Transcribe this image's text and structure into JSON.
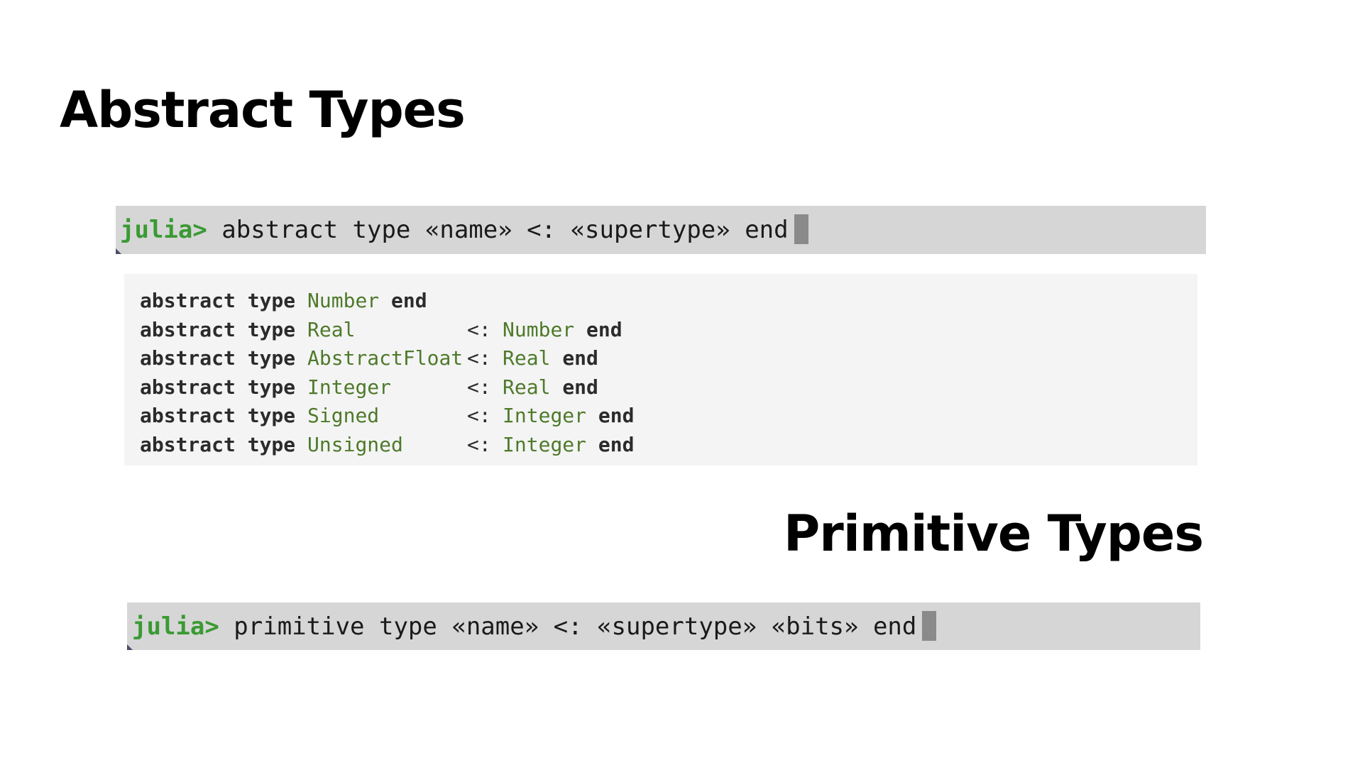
{
  "headings": {
    "abstract": "Abstract Types",
    "primitive": "Primitive Types"
  },
  "repl_abstract": {
    "prompt": "julia>",
    "command": " abstract type «name» <: «supertype» end"
  },
  "repl_primitive": {
    "prompt": "julia>",
    "command": " primitive type «name» <: «supertype» «bits» end"
  },
  "code": {
    "keyword_abstract_type": "abstract type",
    "keyword_end": "end",
    "subtype_operator": "<:",
    "lines": [
      {
        "type_name": "Number",
        "supertype": ""
      },
      {
        "type_name": "Real",
        "supertype": "Number"
      },
      {
        "type_name": "AbstractFloat",
        "supertype": "Real"
      },
      {
        "type_name": "Integer",
        "supertype": "Real"
      },
      {
        "type_name": "Signed",
        "supertype": "Integer"
      },
      {
        "type_name": "Unsigned",
        "supertype": "Integer"
      }
    ]
  },
  "colors": {
    "prompt_green": "#3a9a33",
    "type_green": "#4e7a2a",
    "repl_background": "#d6d6d6",
    "code_background": "#f4f4f4",
    "cursor": "#8a8a8a"
  }
}
